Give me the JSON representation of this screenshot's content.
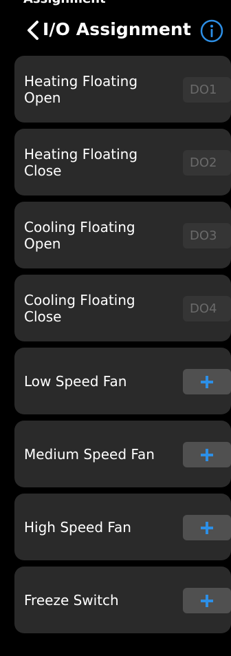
{
  "header": {
    "title": "I/O Assignment",
    "top_cropped_text": "Assignment"
  },
  "colors": {
    "background": "#000000",
    "card": "#2a2a2a",
    "accent": "#2d8fe6",
    "tag_bg": "#353535",
    "tag_text": "#6a6a6a",
    "add_bg": "#505050"
  },
  "icons": {
    "back": "chevron-left-icon",
    "info": "info-icon",
    "add": "plus-icon"
  },
  "items": [
    {
      "label": "Heating Floating Open",
      "tag": "DO1"
    },
    {
      "label": "Heating Floating Close",
      "tag": "DO2"
    },
    {
      "label": "Cooling Floating Open",
      "tag": "DO3"
    },
    {
      "label": "Cooling Floating Close",
      "tag": "DO4"
    },
    {
      "label": "Low Speed Fan"
    },
    {
      "label": "Medium Speed Fan"
    },
    {
      "label": "High Speed Fan"
    },
    {
      "label": "Freeze Switch"
    }
  ]
}
